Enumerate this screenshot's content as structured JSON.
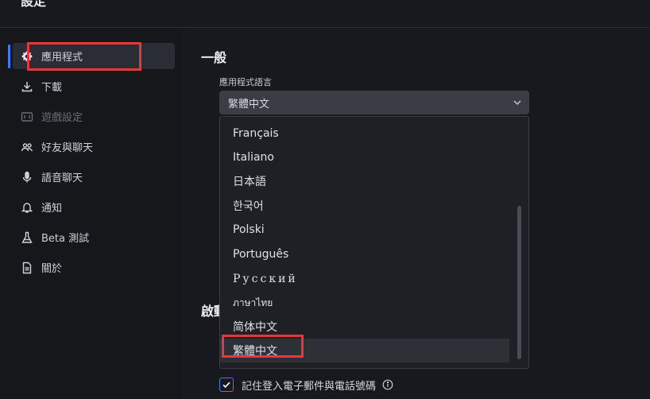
{
  "window": {
    "title": "設定"
  },
  "sidebar": {
    "items": [
      {
        "label": "應用程式",
        "icon": "gear-icon",
        "active": true
      },
      {
        "label": "下載",
        "icon": "download-icon"
      },
      {
        "label": "遊戲設定",
        "icon": "game-controller-icon",
        "disabled": true
      },
      {
        "label": "好友與聊天",
        "icon": "friends-icon"
      },
      {
        "label": "語音聊天",
        "icon": "microphone-icon"
      },
      {
        "label": "通知",
        "icon": "bell-icon"
      },
      {
        "label": "Beta 測試",
        "icon": "flask-icon"
      },
      {
        "label": "關於",
        "icon": "document-icon"
      }
    ]
  },
  "main": {
    "general_title": "一般",
    "language_label": "應用程式語言",
    "language_value": "繁體中文",
    "language_options": [
      "Français",
      "Italiano",
      "日本語",
      "한국어",
      "Polski",
      "Português",
      "Русский",
      "ภาษาไทย",
      "简体中文",
      "繁體中文"
    ],
    "selected_option": "繁體中文",
    "startup_title_partial": "啟動",
    "remember_label": "記住登入電子郵件與電話號碼",
    "remember_checked": true
  },
  "colors": {
    "accent": "#3d7bfd",
    "highlight": "#e8373b",
    "background": "#17191e"
  }
}
